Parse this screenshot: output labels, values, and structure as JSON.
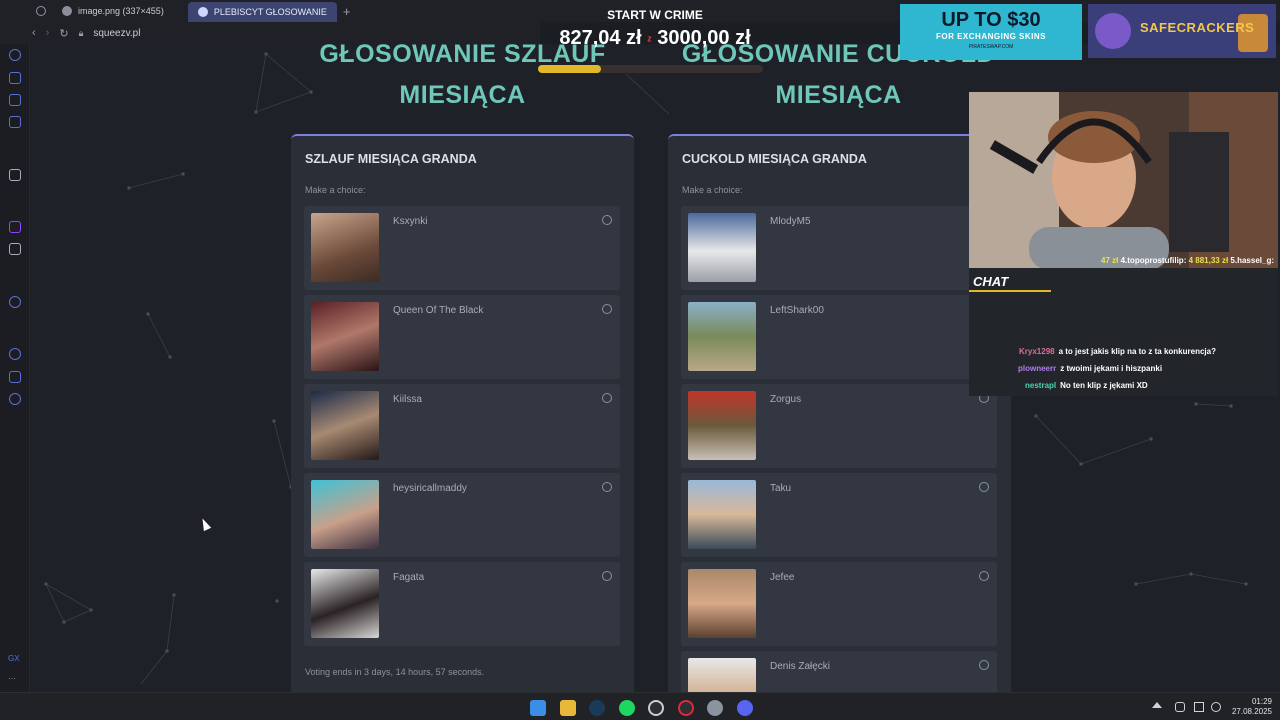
{
  "browser": {
    "tabs": [
      {
        "label": "image.png (337×455)",
        "active": false
      },
      {
        "label": "PLEBISCYT GŁOSOWANIE",
        "active": true
      }
    ],
    "new_tab_icon": "plus-icon",
    "url": "squeezv.pl"
  },
  "page": {
    "left_heading": "GŁOSOWANIE SZLAUF MIESIĄCA",
    "right_heading": "GŁOSOWANIE CUCKOLD MIESIĄCA",
    "left_card": {
      "title": "SZLAUF MIESIĄCA GRANDA",
      "hint": "Make a choice:",
      "options": [
        "Ksxynki",
        "Queen Of The Black",
        "Kiilssa",
        "heysiricallmaddy",
        "Fagata"
      ],
      "footer": "Voting ends in 3 days, 14 hours, 57 seconds."
    },
    "right_card": {
      "title": "CUCKOLD MIESIĄCA GRANDA",
      "hint": "Make a choice:",
      "options": [
        "MlodyM5",
        "LeftShark00",
        "Zorgus",
        "Taku",
        "Jefee",
        "Denis Załęcki"
      ]
    }
  },
  "overlay": {
    "goal_title": "START W CRIME",
    "goal_current": "827,04 zł",
    "goal_separator": "z",
    "goal_target": "3000,00 zł",
    "goal_progress": 0.28,
    "ad1_big": "UP TO $30",
    "ad1_small": "FOR EXCHANGING SKINS",
    "ad1_tiny": "PIRATESWAP.COM",
    "ad2_text": "SAFECRACKERS",
    "ticker": [
      {
        "text": "47 zł",
        "yellow": true
      },
      {
        "text": "4.topoprostufilip:",
        "yellow": false
      },
      {
        "text": "4 881,33 zł",
        "yellow": true
      },
      {
        "text": "5.hassel_g:",
        "yellow": false
      }
    ],
    "chat_title": "CHAT",
    "chat": [
      {
        "user": "Kryx1298",
        "text": "a to jest jakis klip na to z ta konkurencja?",
        "color": "#e06b9a"
      },
      {
        "user": "plowneerr",
        "text": "z twoimi jękami i hiszpanki",
        "color": "#b57cf0"
      },
      {
        "user": "nestrapl",
        "text": "No ten klip z jękami XD",
        "color": "#4ad6b4"
      }
    ]
  },
  "taskbar": {
    "time": "01:29",
    "date": "27.08.2025",
    "apps": [
      "windows-start-icon",
      "file-explorer-icon",
      "steam-icon",
      "spotify-icon",
      "chrome-icon",
      "opera-icon",
      "settings-icon",
      "discord-icon"
    ]
  },
  "colors": {
    "accent": "#7c7fe0",
    "heading": "#6fc7ba",
    "card": "#2a2e36",
    "option": "#323741"
  }
}
